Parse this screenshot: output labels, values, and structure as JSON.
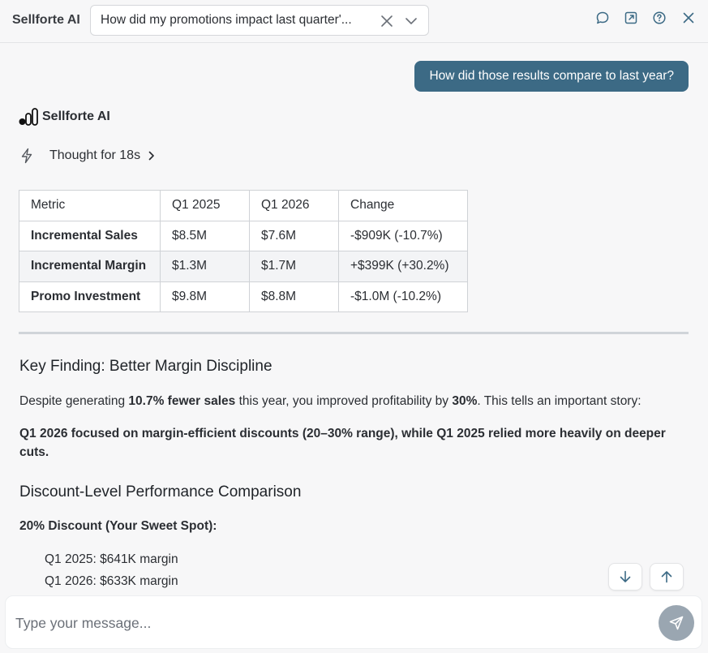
{
  "header": {
    "brand": "Sellforte AI",
    "query": "How did my promotions impact last quarter'...",
    "icons": [
      "chat-bubble-icon",
      "external-link-icon",
      "help-icon",
      "close-icon"
    ]
  },
  "chat": {
    "user_message": "How did those results compare to last year?",
    "assistant_name": "Sellforte AI",
    "thought_label": "Thought for 18s",
    "table": {
      "headers": [
        "Metric",
        "Q1 2025",
        "Q1 2026",
        "Change"
      ],
      "rows": [
        [
          "Incremental Sales",
          "$8.5M",
          "$7.6M",
          "-$909K (-10.7%)"
        ],
        [
          "Incremental Margin",
          "$1.3M",
          "$1.7M",
          "+$399K (+30.2%)"
        ],
        [
          "Promo Investment",
          "$9.8M",
          "$8.8M",
          "-$1.0M (-10.2%)"
        ]
      ]
    },
    "key_finding_title": "Key Finding: Better Margin Discipline",
    "para1": {
      "t1": "Despite generating ",
      "b1": "10.7% fewer sales",
      "t2": " this year, you improved profitability by ",
      "b2": "30%",
      "t3": ". This tells an important story:"
    },
    "para2": "Q1 2026 focused on margin-efficient discounts (20–30% range), while Q1 2025 relied more heavily on deeper cuts.",
    "comparison_title": "Discount-Level Performance Comparison",
    "discount_20_label": "20% Discount (Your Sweet Spot):",
    "discount_20_items": [
      "Q1 2025: $641K margin",
      "Q1 2026: $633K margin"
    ]
  },
  "composer": {
    "placeholder": "Type your message..."
  },
  "colors": {
    "user_bubble": "#3c6a85",
    "send_button": "#9aa6b1"
  }
}
